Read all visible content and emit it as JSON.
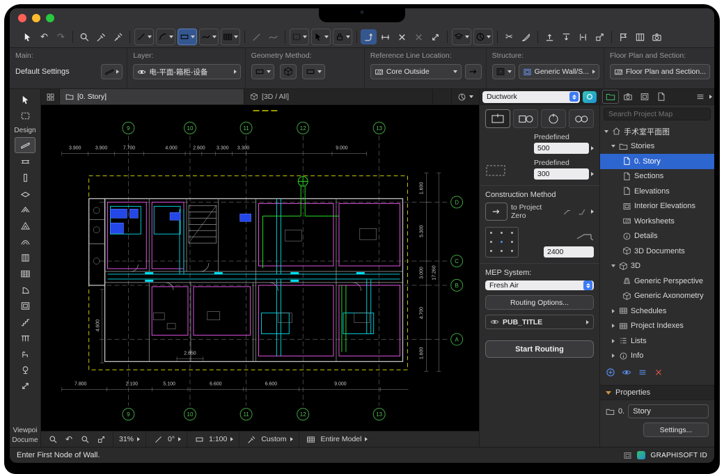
{
  "colors": {
    "accent_blue": "#2e66d0",
    "stepper_blue": "#3d7bf5",
    "selection_yellow": "#c9c900",
    "duct_cyan": "#00e0f0",
    "pipe_magenta": "#e052e0",
    "duct_green": "#27d827",
    "equipment_blue": "#2447e8",
    "grid_green": "#4db84d",
    "traffic_red": "#ff5f57",
    "traffic_yellow": "#febc2e",
    "traffic_green": "#28c840"
  },
  "infobox": {
    "main_label": "Main:",
    "main_value": "Default Settings",
    "layer_label": "Layer:",
    "layer_value": "电-平面-箱柜-设备",
    "geometry_label": "Geometry Method:",
    "refline_label": "Reference Line Location:",
    "refline_value": "Core Outside",
    "structure_label": "Structure:",
    "structure_value": "Generic Wall/S...",
    "floorplan_label": "Floor Plan and Section:",
    "floorplan_value": "Floor Plan and Section..."
  },
  "tabs": {
    "story_tab": "[0. Story]",
    "three_d_tab": "[3D / All]"
  },
  "palette": {
    "design_label": "Design",
    "viewpoint_label": "Viewpoi",
    "document_label": "Docume"
  },
  "tool_panel": {
    "element_type": "Ductwork",
    "predefined1": "Predefined",
    "width": "500",
    "predefined2": "Predefined",
    "height": "300",
    "construction_method": "Construction Method",
    "anchor": "to Project Zero",
    "elevation": "2400",
    "mep_label": "MEP System:",
    "mep_value": "Fresh Air",
    "routing_options": "Routing Options...",
    "pub_title": "PUB_TITLE",
    "start_routing": "Start Routing"
  },
  "navigator": {
    "search_placeholder": "Search Project Map",
    "tree": [
      {
        "label": "手术室平面图"
      },
      {
        "label": "Stories"
      },
      {
        "label": "0. Story",
        "selected": true
      },
      {
        "label": "Sections"
      },
      {
        "label": "Elevations"
      },
      {
        "label": "Interior Elevations"
      },
      {
        "label": "Worksheets"
      },
      {
        "label": "Details"
      },
      {
        "label": "3D Documents"
      },
      {
        "label": "3D"
      },
      {
        "label": "Generic Perspective"
      },
      {
        "label": "Generic Axonometry"
      },
      {
        "label": "Schedules"
      },
      {
        "label": "Project Indexes"
      },
      {
        "label": "Lists"
      },
      {
        "label": "Info"
      }
    ],
    "properties_label": "Properties",
    "story_number": "0.",
    "story_name": "Story",
    "settings": "Settings..."
  },
  "bottom_bar": {
    "zoom": "31%",
    "angle": "0°",
    "scale": "1:100",
    "pen_set": "Custom",
    "filter": "Entire Model"
  },
  "status": {
    "message": "Enter First Node of Wall.",
    "brand": "GRAPHISOFT ID"
  },
  "canvas": {
    "grid_columns": [
      "9",
      "10",
      "11",
      "12",
      "13"
    ],
    "grid_rows": [
      "D",
      "C",
      "B",
      "A"
    ],
    "dims_top": [
      "3.900",
      "3.900",
      "7.700",
      "4.000",
      "2.600",
      "3.300",
      "3.300",
      "9.000"
    ],
    "dims_bottom": [
      "7.800",
      "2.100",
      "5.100",
      "6.600",
      "6.600",
      "9.000"
    ],
    "dims_right": [
      "1.600",
      "5.300",
      "3.000",
      "4.700",
      "1.600"
    ],
    "dim_total_right": "17.260",
    "dim_left": "4.600",
    "dim_inner": "2.650"
  }
}
